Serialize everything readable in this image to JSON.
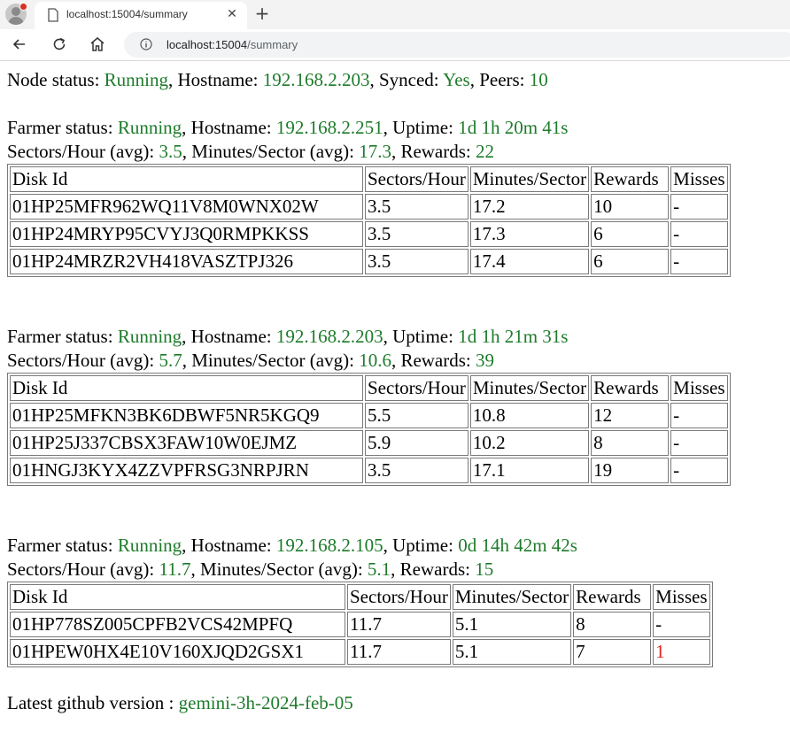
{
  "browser": {
    "tab_title": "localhost:15004/summary",
    "url_host": "localhost:15004",
    "url_path": "/summary"
  },
  "node": {
    "status_label": "Node status: ",
    "status": "Running",
    "hostname_label": ", Hostname: ",
    "hostname": "192.168.2.203",
    "synced_label": ", Synced: ",
    "synced": "Yes",
    "peers_label": ", Peers: ",
    "peers": "10"
  },
  "labels": {
    "farmer_status": "Farmer status: ",
    "hostname": ", Hostname: ",
    "uptime": ", Uptime: ",
    "sph_avg": "Sectors/Hour (avg): ",
    "mps_avg": ", Minutes/Sector (avg): ",
    "rewards": ", Rewards: ",
    "version": "Latest github version : "
  },
  "table_headers": [
    "Disk Id",
    "Sectors/Hour",
    "Minutes/Sector",
    "Rewards",
    "Misses"
  ],
  "farmers": [
    {
      "status": "Running",
      "hostname": "192.168.2.251",
      "uptime": "1d 1h 20m 41s",
      "sph": "3.5",
      "mps": "17.3",
      "rewards": "22",
      "rows": [
        [
          "01HP25MFR962WQ11V8M0WNX02W",
          "3.5",
          "17.2",
          "10",
          "-"
        ],
        [
          "01HP24MRYP95CVYJ3Q0RMPKKSS",
          "3.5",
          "17.3",
          "6",
          "-"
        ],
        [
          "01HP24MRZR2VH418VASZTPJ326",
          "3.5",
          "17.4",
          "6",
          "-"
        ]
      ]
    },
    {
      "status": "Running",
      "hostname": "192.168.2.203",
      "uptime": "1d 1h 21m 31s",
      "sph": "5.7",
      "mps": "10.6",
      "rewards": "39",
      "rows": [
        [
          "01HP25MFKN3BK6DBWF5NR5KGQ9",
          "5.5",
          "10.8",
          "12",
          "-"
        ],
        [
          "01HP25J337CBSX3FAW10W0EJMZ",
          "5.9",
          "10.2",
          "8",
          "-"
        ],
        [
          "01HNGJ3KYX4ZZVPFRSG3NRPJRN",
          "3.5",
          "17.1",
          "19",
          "-"
        ]
      ]
    },
    {
      "status": "Running",
      "hostname": "192.168.2.105",
      "uptime": "0d 14h 42m 42s",
      "sph": "11.7",
      "mps": "5.1",
      "rewards": "15",
      "rows": [
        [
          "01HP778SZ005CPFB2VCS42MPFQ",
          "11.7",
          "5.1",
          "8",
          "-"
        ],
        [
          "01HPEW0HX4E10V160XJQD2GSX1",
          "11.7",
          "5.1",
          "7",
          "1"
        ]
      ]
    }
  ],
  "version": "gemini-3h-2024-feb-05",
  "colors": {
    "value_green": "#1e7b2b",
    "miss_red": "#e0241b"
  }
}
